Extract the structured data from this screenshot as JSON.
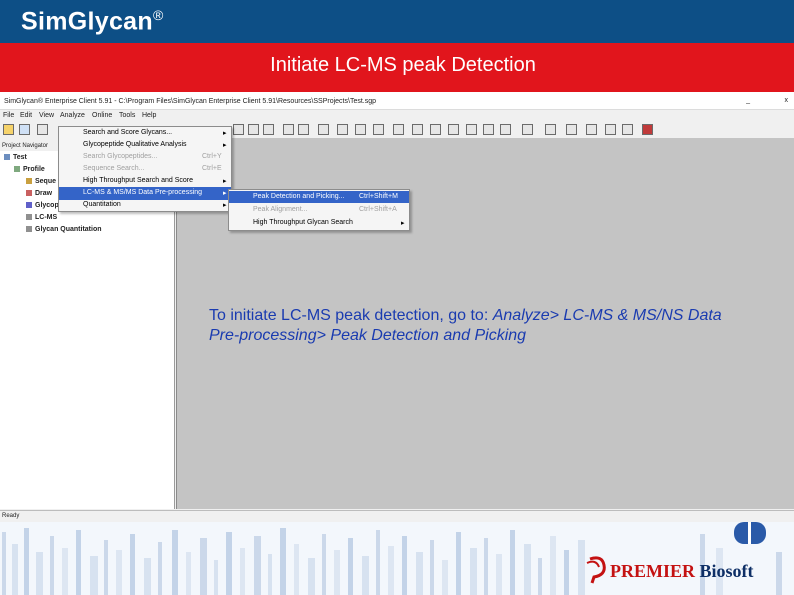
{
  "slide": {
    "brand": "SimGlycan",
    "brand_mark": "®",
    "title": "Initiate LC-MS peak Detection",
    "instruction_prefix": "To initiate LC-MS peak detection, go to: ",
    "instruction_path": "Analyze> LC-MS & MS/NS Data Pre-processing> Peak Detection and Picking"
  },
  "app": {
    "window_title": "SimGlycan® Enterprise Client 5.91 - C:\\Program Files\\SimGlycan Enterprise Client 5.91\\Resources\\SSProjects\\Test.sgp",
    "window_controls": {
      "minimize": "_",
      "close": "x"
    },
    "menubar": [
      "File",
      "Edit",
      "View",
      "Analyze",
      "Online",
      "Tools",
      "Help"
    ],
    "navigator_label": "Project Navigator",
    "tree": [
      "Test",
      "Profile",
      "Seque",
      "Draw",
      "Glycop",
      "LC-MS",
      "Glycan Quantitation"
    ],
    "status": "Ready"
  },
  "analyze_menu": [
    {
      "label": "Search and Score Glycans...",
      "shortcut": "",
      "arrow": "▸",
      "state": "normal"
    },
    {
      "label": "Glycopeptide Qualitative Analysis",
      "shortcut": "",
      "arrow": "▸",
      "state": "normal"
    },
    {
      "label": "Search Glycopeptides...",
      "shortcut": "Ctrl+Y",
      "arrow": "",
      "state": "disabled"
    },
    {
      "label": "Sequence Search...",
      "shortcut": "Ctrl+E",
      "arrow": "",
      "state": "disabled"
    },
    {
      "label": "High Throughput Search and Score",
      "shortcut": "",
      "arrow": "▸",
      "state": "normal"
    },
    {
      "label": "LC-MS & MS/MS Data Pre-processing",
      "shortcut": "",
      "arrow": "▸",
      "state": "highlighted"
    },
    {
      "label": "Quantitation",
      "shortcut": "",
      "arrow": "▸",
      "state": "normal"
    }
  ],
  "submenu": [
    {
      "label": "Peak Detection and Picking...",
      "shortcut": "Ctrl+Shift+M",
      "arrow": "",
      "state": "highlighted"
    },
    {
      "label": "Peak Alignment...",
      "shortcut": "Ctrl+Shift+A",
      "arrow": "",
      "state": "disabled"
    },
    {
      "label": "High Throughput Glycan Search",
      "shortcut": "",
      "arrow": "▸",
      "state": "normal"
    }
  ],
  "footer": {
    "logo_p": "P",
    "company_red": "PREMIER",
    "company_blue": " Biosoft"
  },
  "colors": {
    "header_blue": "#0d4f86",
    "title_red": "#e1151c",
    "menu_highlight": "#3464c8",
    "instruction_blue": "#1a3bb0",
    "logo_red": "#c41212",
    "logo_navy": "#0e2f66"
  }
}
